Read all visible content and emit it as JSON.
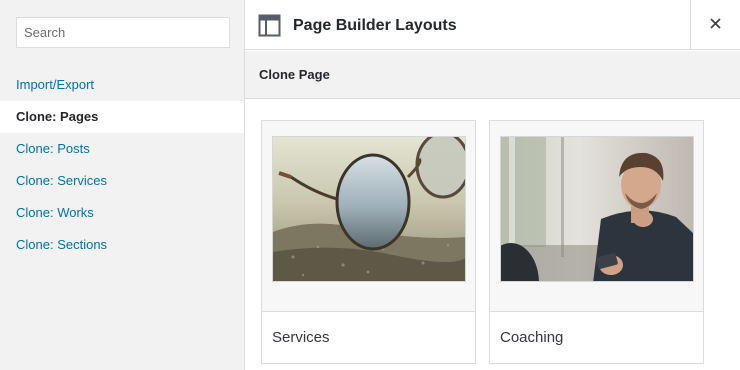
{
  "sidebar": {
    "search_placeholder": "Search",
    "items": [
      {
        "label": "Import/Export",
        "active": false
      },
      {
        "label": "Clone: Pages",
        "active": true
      },
      {
        "label": "Clone: Posts",
        "active": false
      },
      {
        "label": "Clone: Services",
        "active": false
      },
      {
        "label": "Clone: Works",
        "active": false
      },
      {
        "label": "Clone: Sections",
        "active": false
      }
    ]
  },
  "header": {
    "title": "Page Builder Layouts",
    "icon": "layout-icon",
    "close_icon": "close-icon"
  },
  "subheader": {
    "title": "Clone Page"
  },
  "layouts": [
    {
      "label": "Services",
      "thumbnail": "sunglasses-on-rock"
    },
    {
      "label": "Coaching",
      "thumbnail": "man-with-smartphone"
    }
  ],
  "colors": {
    "link": "#0073aa",
    "text": "#23282d",
    "sidebar_bg": "#f2f2f2",
    "border": "#dcdcdc"
  }
}
